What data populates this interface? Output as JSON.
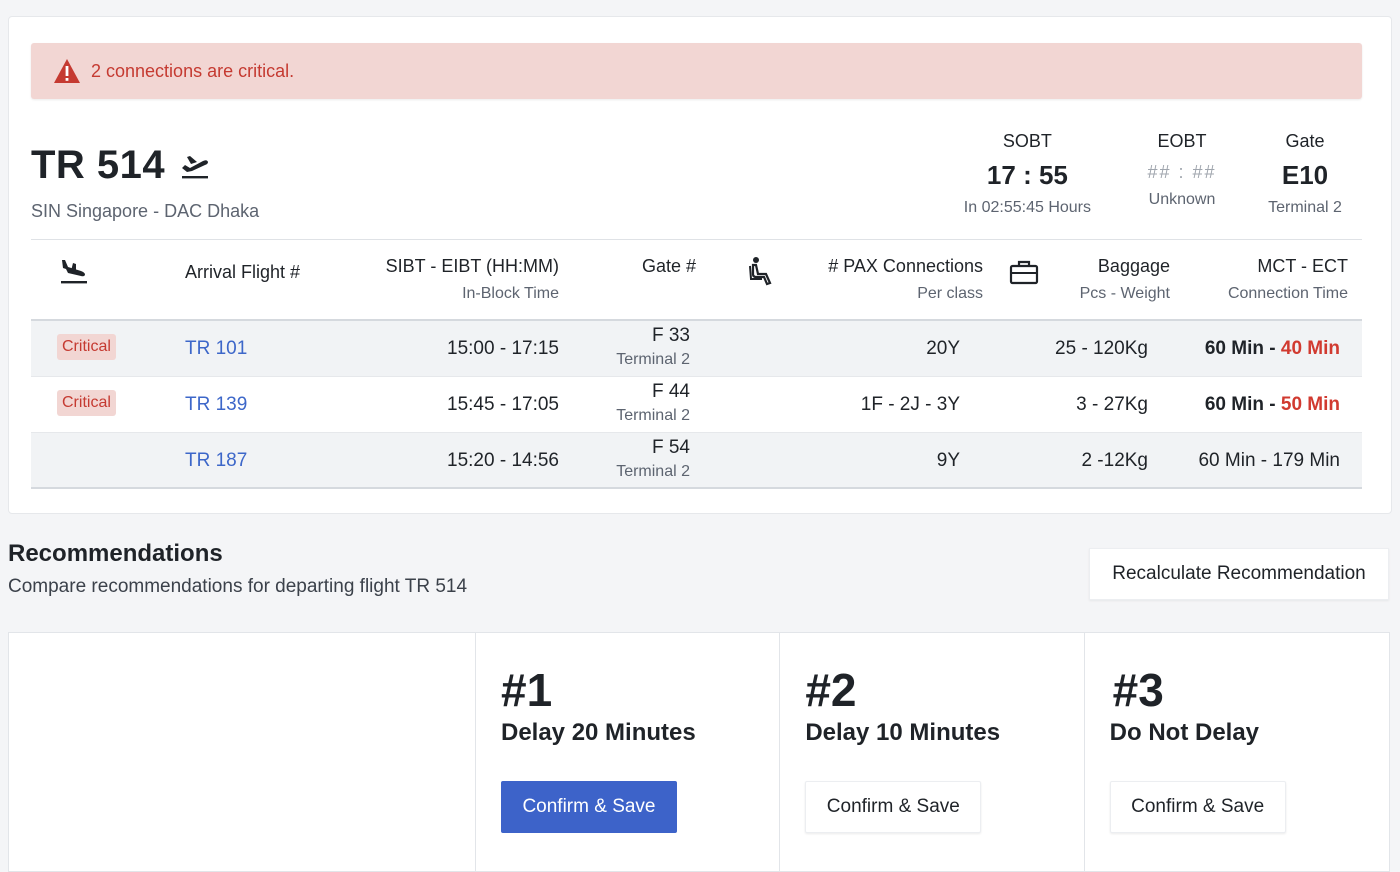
{
  "alert": {
    "text": "2 connections are critical.",
    "icon": "warning-triangle-icon"
  },
  "flight": {
    "number": "TR 514",
    "route": "SIN Singapore - DAC Dhaka",
    "icon": "departure-plane-icon"
  },
  "stats": {
    "sobt": {
      "label": "SOBT",
      "value": "17 : 55",
      "sub": "In 02:55:45 Hours"
    },
    "eobt": {
      "label": "EOBT",
      "value": "## : ##",
      "sub": "Unknown"
    },
    "gate": {
      "label": "Gate",
      "value": "E10",
      "sub": "Terminal 2"
    }
  },
  "table": {
    "headers": {
      "arrival_flight": "Arrival Flight #",
      "sibt_eibt": "SIBT - EIBT (HH:MM)",
      "sibt_eibt_sub": "In-Block Time",
      "gate": "Gate #",
      "pax": "# PAX Connections",
      "pax_sub": "Per class",
      "baggage": "Baggage",
      "baggage_sub": "Pcs - Weight",
      "mct": "MCT - ECT",
      "mct_sub": "Connection Time"
    },
    "rows": [
      {
        "status": "Critical",
        "flight": "TR 101",
        "times": "15:00 - 17:15",
        "gate": "F 33",
        "terminal": "Terminal 2",
        "pax": "20Y",
        "baggage": "25 - 120Kg",
        "mct": "60 Min",
        "sep": " - ",
        "ect": "40 Min"
      },
      {
        "status": "Critical",
        "flight": "TR 139",
        "times": "15:45 - 17:05",
        "gate": "F 44",
        "terminal": "Terminal 2",
        "pax": "1F - 2J - 3Y",
        "baggage": "3 - 27Kg",
        "mct": "60 Min",
        "sep": " - ",
        "ect": "50 Min"
      },
      {
        "status": "",
        "flight": "TR 187",
        "times": "15:20 - 14:56",
        "gate": "F 54",
        "terminal": "Terminal 2",
        "pax": "9Y",
        "baggage": "2 -12Kg",
        "mct_plain": "60 Min - 179 Min"
      }
    ]
  },
  "recommendations": {
    "title": "Recommendations",
    "subtitle": "Compare recommendations for departing flight TR 514",
    "recalculate_label": "Recalculate Recommendation",
    "options": [
      {
        "rank": "#1",
        "description": "Delay 20 Minutes",
        "button": "Confirm & Save"
      },
      {
        "rank": "#2",
        "description": "Delay 10 Minutes",
        "button": "Confirm & Save"
      },
      {
        "rank": "#3",
        "description": "Do Not Delay",
        "button": "Confirm & Save"
      }
    ]
  },
  "colors": {
    "critical": "#c53a31",
    "link": "#3d67c9",
    "primary_button": "#3d63c9",
    "alert_bg": "#f2d6d3"
  }
}
